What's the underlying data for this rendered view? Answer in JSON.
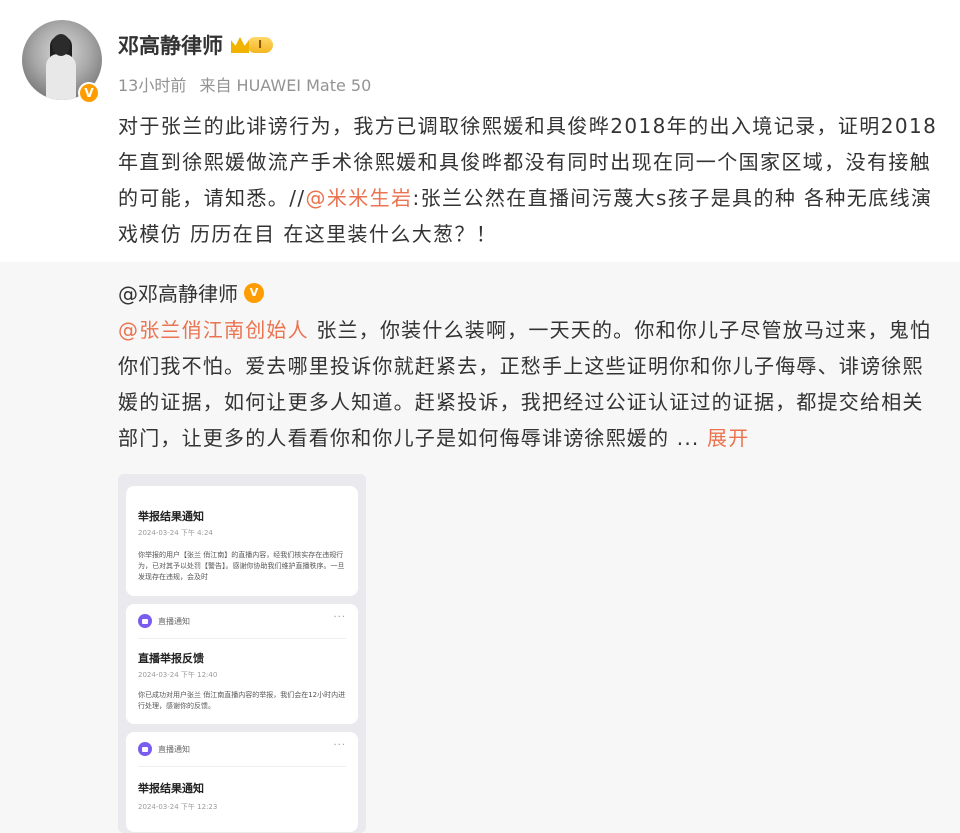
{
  "post": {
    "author": "邓高静律师",
    "level_badge": "I",
    "verified_mark": "V",
    "time": "13小时前",
    "source": "来自 HUAWEI Mate 50",
    "text_before_mention": "对于张兰的此诽谤行为，我方已调取徐熙媛和具俊晔2018年的出入境记录，证明2018年直到徐熙媛做流产手术徐熙媛和具俊晔都没有同时出现在同一个国家区域，没有接触的可能，请知悉。//",
    "mention": "@米米生岩",
    "text_after_mention": ":张兰公然在直播间污蔑大s孩子是具的种 各种无底线演戏模仿 历历在目 在这里装什么大葱？！"
  },
  "repost": {
    "author": "@邓高静律师",
    "verified_mark": "V",
    "mention": "@张兰俏江南创始人",
    "text": " 张兰，你装什么装啊，一天天的。你和你儿子尽管放马过来，鬼怕你们我不怕。爱去哪里投诉你就赶紧去，正愁手上这些证明你和你儿子侮辱、诽谤徐熙媛的证据，如何让更多人知道。赶紧投诉，我把经过公证认证过的证据，都提交给相关部门，让更多的人看看你和你儿子是如何侮辱诽谤徐熙媛的 ... ",
    "expand": "展开"
  },
  "screenshot": {
    "card1": {
      "title": "举报结果通知",
      "time": "2024-03-24 下午 4:24",
      "body": "你举报的用户【张兰 俏江南】的直播内容，经我们核实存在违规行为，已对其予以处罚【警告】。感谢你协助我们维护直播秩序。一旦发现存在违规，会及时"
    },
    "card2": {
      "header": "直播通知",
      "more": "···",
      "title": "直播举报反馈",
      "time": "2024-03-24 下午 12:40",
      "body": "你已成功对用户张兰 俏江南直播内容的举报，我们会在12小时内进行处理，感谢你的反馈。"
    },
    "card3": {
      "header": "直播通知",
      "more": "···",
      "title": "举报结果通知",
      "time": "2024-03-24 下午 12:23"
    }
  }
}
